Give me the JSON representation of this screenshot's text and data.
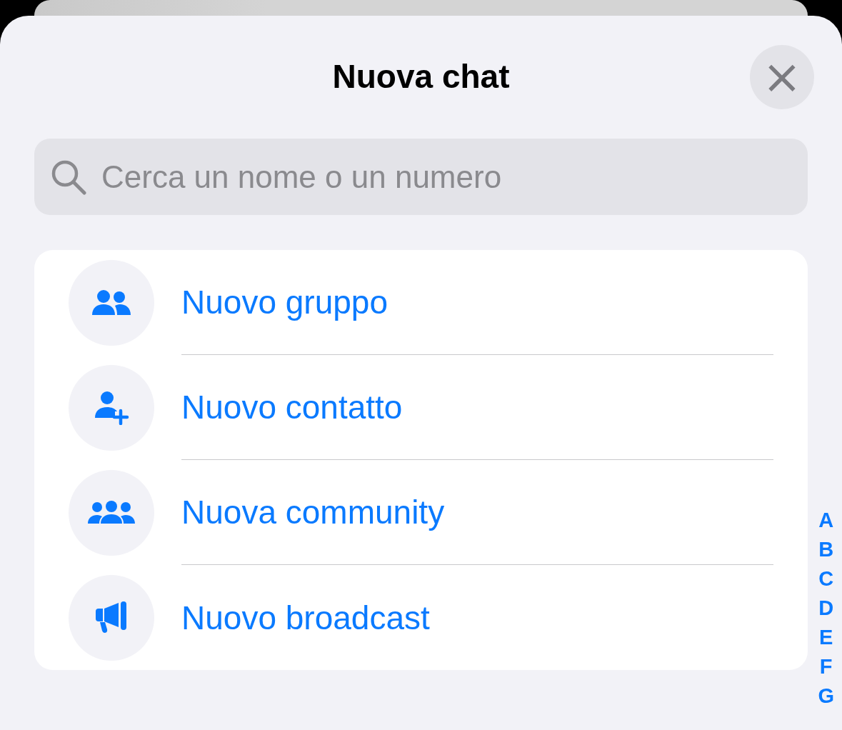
{
  "sheet": {
    "title": "Nuova chat",
    "close_label": "×"
  },
  "search": {
    "placeholder": "Cerca un nome o un numero"
  },
  "actions": [
    {
      "kind": "group",
      "label": "Nuovo gruppo"
    },
    {
      "kind": "contact",
      "label": "Nuovo contatto"
    },
    {
      "kind": "community",
      "label": "Nuova community"
    },
    {
      "kind": "broadcast",
      "label": "Nuovo broadcast"
    }
  ],
  "index_letters": [
    "A",
    "B",
    "C",
    "D",
    "E",
    "F",
    "G"
  ]
}
